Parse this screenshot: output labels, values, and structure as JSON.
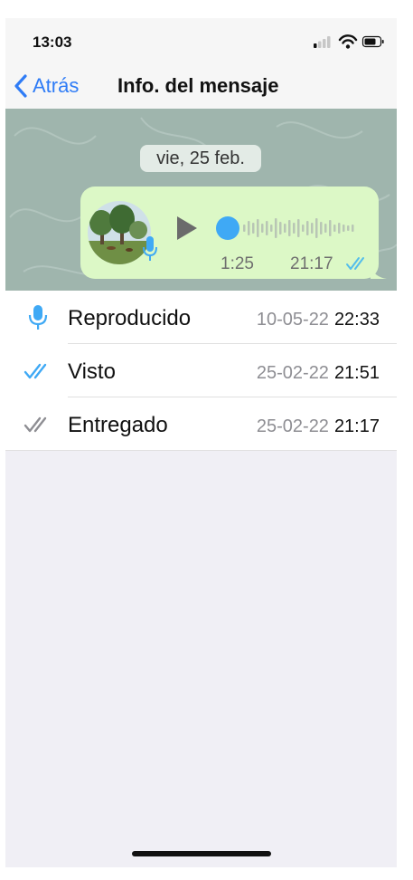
{
  "status_bar": {
    "time": "13:03"
  },
  "nav": {
    "back_label": "Atrás",
    "title": "Info. del mensaje"
  },
  "chat": {
    "date_label": "vie, 25 feb.",
    "voice_message": {
      "duration": "1:25",
      "time": "21:17"
    }
  },
  "receipts": [
    {
      "icon": "microphone-icon",
      "label": "Reproducido",
      "date": "10-05-22",
      "time": "22:33"
    },
    {
      "icon": "double-check-blue-icon",
      "label": "Visto",
      "date": "25-02-22",
      "time": "21:51"
    },
    {
      "icon": "double-check-gray-icon",
      "label": "Entregado",
      "date": "25-02-22",
      "time": "21:17"
    }
  ],
  "colors": {
    "accent_blue": "#2f7cf6",
    "read_tick_blue": "#53bdeb",
    "bubble_green": "#dcf8c6",
    "chat_background": "#9fb5ad"
  }
}
